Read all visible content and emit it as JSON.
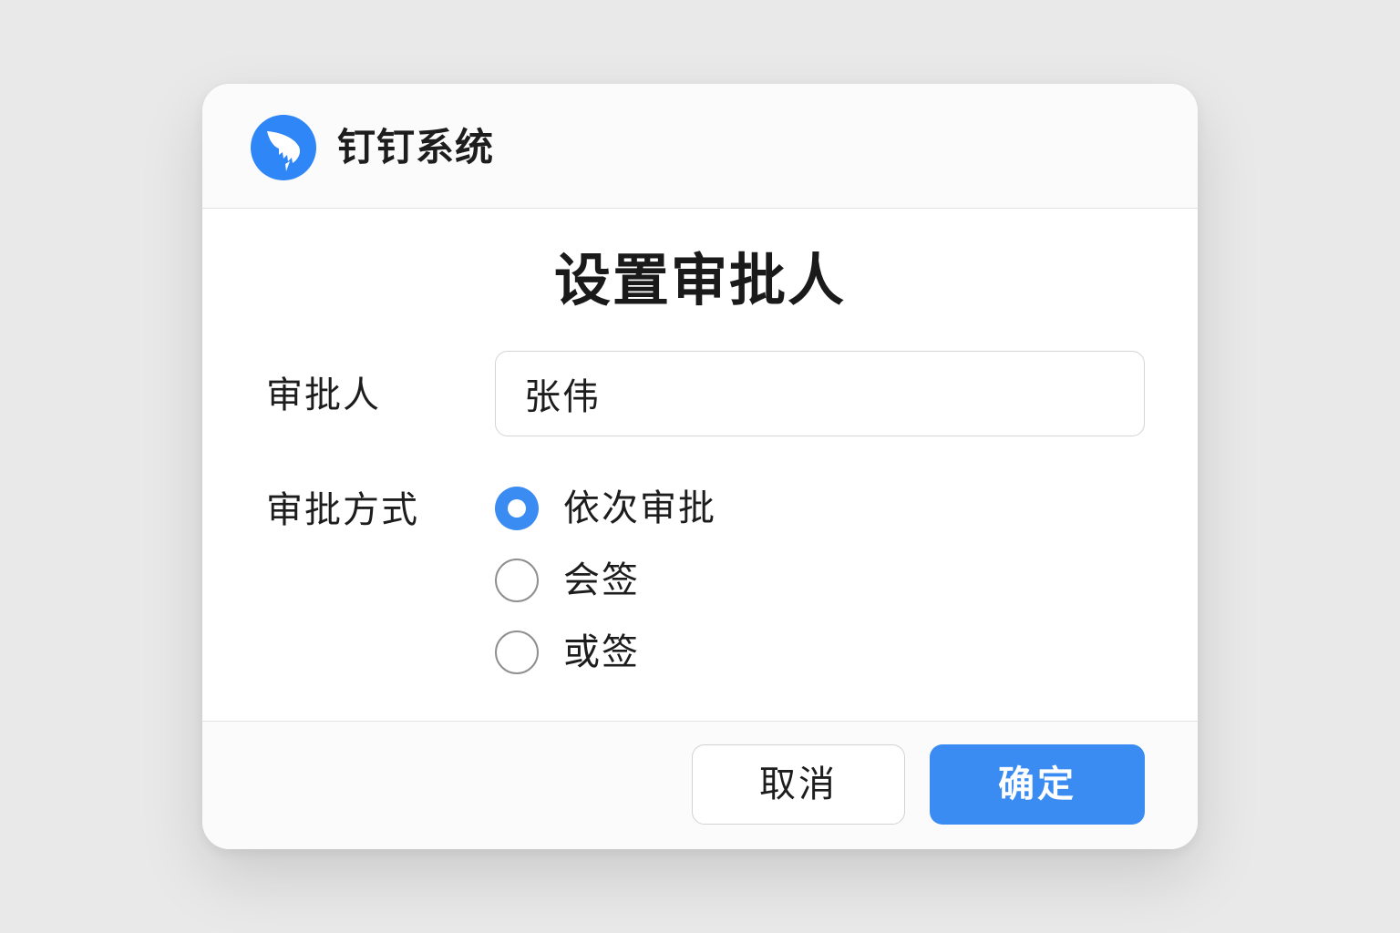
{
  "app": {
    "title": "钉钉系统",
    "logo_icon": "dingtalk-logo-icon",
    "brand_color": "#2f86f6"
  },
  "dialog": {
    "title": "设置审批人"
  },
  "form": {
    "approver": {
      "label": "审批人",
      "value": "张伟"
    },
    "method": {
      "label": "审批方式",
      "options": [
        {
          "label": "依次审批",
          "selected": true
        },
        {
          "label": "会签",
          "selected": false
        },
        {
          "label": "或签",
          "selected": false
        }
      ]
    }
  },
  "footer": {
    "cancel_label": "取消",
    "confirm_label": "确定",
    "confirm_color": "#3a8bf2"
  }
}
